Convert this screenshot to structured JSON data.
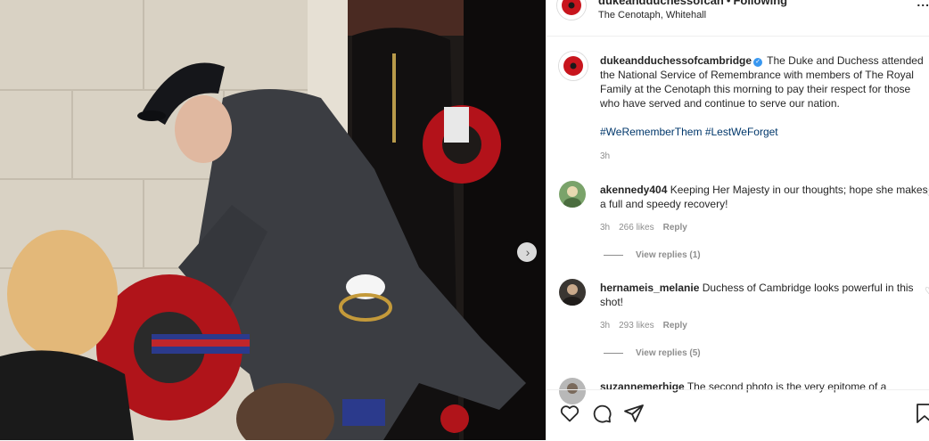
{
  "post": {
    "account": "dukeandduchessofcambridge",
    "header_account_visible": "dukeandduchessofcan",
    "dot": "•",
    "follow_status": "Following",
    "location": "The Cenotaph, Whitehall",
    "more_label": "...",
    "caption": "The Duke and Duchess attended the National Service of Remembrance with members of The Royal Family at the Cenotaph this morning to pay their respect for those who have served and continue to serve our nation.",
    "hashtags": "#WeRememberThem #LestWeForget",
    "time": "3h",
    "verified_mark": "✓"
  },
  "comments": [
    {
      "user": "akennedy404",
      "text": "Keeping Her Majesty in our thoughts; hope she makes a full and speedy recovery!",
      "time": "3h",
      "likes": "266 likes",
      "reply_label": "Reply",
      "view_replies": "View replies (1)"
    },
    {
      "user": "hernameis_melanie",
      "text": "Duchess of Cambridge looks powerful in this shot!",
      "time": "3h",
      "likes": "293 likes",
      "reply_label": "Reply",
      "view_replies": "View replies (5)"
    },
    {
      "user": "suzannemerhige",
      "text": "The second photo is the very epitome of a"
    }
  ],
  "icons": {
    "like": "heart-icon",
    "comment": "comment-icon",
    "share": "share-icon",
    "save": "bookmark-icon",
    "next": "chevron-right-icon"
  },
  "colors": {
    "hashtag": "#00376b",
    "verified": "#3897f0",
    "muted": "#8e8e8e"
  }
}
